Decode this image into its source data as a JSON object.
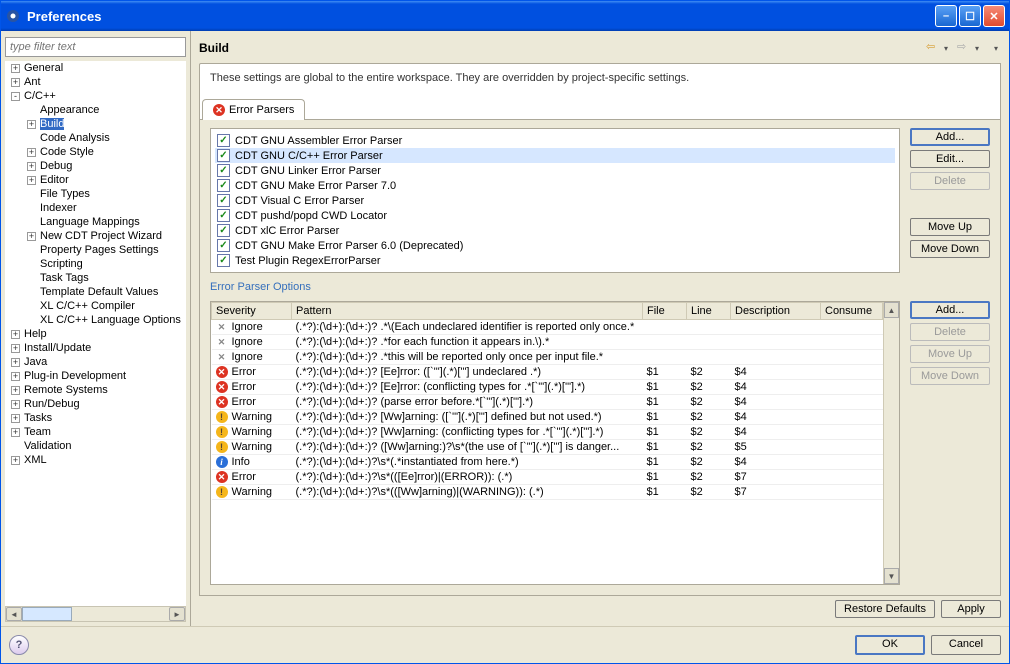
{
  "window": {
    "title": "Preferences"
  },
  "filter": {
    "placeholder": "type filter text"
  },
  "tree": [
    {
      "label": "General",
      "depth": 0,
      "toggle": "+"
    },
    {
      "label": "Ant",
      "depth": 0,
      "toggle": "+"
    },
    {
      "label": "C/C++",
      "depth": 0,
      "toggle": "-"
    },
    {
      "label": "Appearance",
      "depth": 1,
      "toggle": ""
    },
    {
      "label": "Build",
      "depth": 1,
      "toggle": "+",
      "selected": true
    },
    {
      "label": "Code Analysis",
      "depth": 1,
      "toggle": ""
    },
    {
      "label": "Code Style",
      "depth": 1,
      "toggle": "+"
    },
    {
      "label": "Debug",
      "depth": 1,
      "toggle": "+"
    },
    {
      "label": "Editor",
      "depth": 1,
      "toggle": "+"
    },
    {
      "label": "File Types",
      "depth": 1,
      "toggle": ""
    },
    {
      "label": "Indexer",
      "depth": 1,
      "toggle": ""
    },
    {
      "label": "Language Mappings",
      "depth": 1,
      "toggle": ""
    },
    {
      "label": "New CDT Project Wizard",
      "depth": 1,
      "toggle": "+"
    },
    {
      "label": "Property Pages Settings",
      "depth": 1,
      "toggle": ""
    },
    {
      "label": "Scripting",
      "depth": 1,
      "toggle": ""
    },
    {
      "label": "Task Tags",
      "depth": 1,
      "toggle": ""
    },
    {
      "label": "Template Default Values",
      "depth": 1,
      "toggle": ""
    },
    {
      "label": "XL C/C++ Compiler",
      "depth": 1,
      "toggle": ""
    },
    {
      "label": "XL C/C++ Language Options",
      "depth": 1,
      "toggle": ""
    },
    {
      "label": "Help",
      "depth": 0,
      "toggle": "+"
    },
    {
      "label": "Install/Update",
      "depth": 0,
      "toggle": "+"
    },
    {
      "label": "Java",
      "depth": 0,
      "toggle": "+"
    },
    {
      "label": "Plug-in Development",
      "depth": 0,
      "toggle": "+"
    },
    {
      "label": "Remote Systems",
      "depth": 0,
      "toggle": "+"
    },
    {
      "label": "Run/Debug",
      "depth": 0,
      "toggle": "+"
    },
    {
      "label": "Tasks",
      "depth": 0,
      "toggle": "+"
    },
    {
      "label": "Team",
      "depth": 0,
      "toggle": "+"
    },
    {
      "label": "Validation",
      "depth": 0,
      "toggle": ""
    },
    {
      "label": "XML",
      "depth": 0,
      "toggle": "+"
    }
  ],
  "page": {
    "title": "Build",
    "description": "These settings are global to the entire workspace.  They are overridden by project-specific settings.",
    "tab_label": "Error Parsers",
    "options_label": "Error Parser Options"
  },
  "parsers": [
    {
      "label": "CDT GNU Assembler Error Parser",
      "checked": true
    },
    {
      "label": "CDT GNU C/C++ Error Parser",
      "checked": true,
      "selected": true
    },
    {
      "label": "CDT GNU Linker Error Parser",
      "checked": true
    },
    {
      "label": "CDT GNU Make Error Parser 7.0",
      "checked": true
    },
    {
      "label": "CDT Visual C Error Parser",
      "checked": true
    },
    {
      "label": "CDT pushd/popd CWD Locator",
      "checked": true
    },
    {
      "label": "CDT xlC Error Parser",
      "checked": true
    },
    {
      "label": "CDT GNU Make Error Parser 6.0 (Deprecated)",
      "checked": true
    },
    {
      "label": "Test Plugin RegexErrorParser",
      "checked": true
    }
  ],
  "parsers_buttons": {
    "add": "Add...",
    "edit": "Edit...",
    "delete": "Delete",
    "moveup": "Move Up",
    "movedown": "Move Down"
  },
  "opts_buttons": {
    "add": "Add...",
    "delete": "Delete",
    "moveup": "Move Up",
    "movedown": "Move Down"
  },
  "columns": {
    "severity": "Severity",
    "pattern": "Pattern",
    "file": "File",
    "line": "Line",
    "description": "Description",
    "consume": "Consume"
  },
  "rows": [
    {
      "sev": "Ignore",
      "pat": "(.*?):(\\d+):(\\d+:)? .*\\(Each undeclared identifier is reported only once.*",
      "file": "",
      "line": "",
      "desc": "",
      "cons": ""
    },
    {
      "sev": "Ignore",
      "pat": "(.*?):(\\d+):(\\d+:)? .*for each function it appears in.\\).*",
      "file": "",
      "line": "",
      "desc": "",
      "cons": ""
    },
    {
      "sev": "Ignore",
      "pat": "(.*?):(\\d+):(\\d+:)? .*this will be reported only once per input file.*",
      "file": "",
      "line": "",
      "desc": "",
      "cons": ""
    },
    {
      "sev": "Error",
      "pat": "(.*?):(\\d+):(\\d+:)? [Ee]rror: ([`'\"](.*)['\"] undeclared .*)",
      "file": "$1",
      "line": "$2",
      "desc": "$4",
      "cons": ""
    },
    {
      "sev": "Error",
      "pat": "(.*?):(\\d+):(\\d+:)? [Ee]rror: (conflicting types for .*[`'\"](.*)['\"].*)",
      "file": "$1",
      "line": "$2",
      "desc": "$4",
      "cons": ""
    },
    {
      "sev": "Error",
      "pat": "(.*?):(\\d+):(\\d+:)? (parse error before.*[`'\"](.*)['\"].*)",
      "file": "$1",
      "line": "$2",
      "desc": "$4",
      "cons": ""
    },
    {
      "sev": "Warning",
      "pat": "(.*?):(\\d+):(\\d+:)? [Ww]arning: ([`'\"](.*)['\"] defined but not used.*)",
      "file": "$1",
      "line": "$2",
      "desc": "$4",
      "cons": ""
    },
    {
      "sev": "Warning",
      "pat": "(.*?):(\\d+):(\\d+:)? [Ww]arning: (conflicting types for .*[`'\"](.*)['\"].*)",
      "file": "$1",
      "line": "$2",
      "desc": "$4",
      "cons": ""
    },
    {
      "sev": "Warning",
      "pat": "(.*?):(\\d+):(\\d+:)? ([Ww]arning:)?\\s*(the use of [`'\"](.*)['\"] is danger...",
      "file": "$1",
      "line": "$2",
      "desc": "$5",
      "cons": ""
    },
    {
      "sev": "Info",
      "pat": "(.*?):(\\d+):(\\d+:)?\\s*(.*instantiated from here.*)",
      "file": "$1",
      "line": "$2",
      "desc": "$4",
      "cons": ""
    },
    {
      "sev": "Error",
      "pat": "(.*?):(\\d+):(\\d+:)?\\s*(([Ee]rror)|(ERROR)): (.*)",
      "file": "$1",
      "line": "$2",
      "desc": "$7",
      "cons": ""
    },
    {
      "sev": "Warning",
      "pat": "(.*?):(\\d+):(\\d+:)?\\s*(([Ww]arning)|(WARNING)): (.*)",
      "file": "$1",
      "line": "$2",
      "desc": "$7",
      "cons": ""
    }
  ],
  "footer": {
    "restore": "Restore Defaults",
    "apply": "Apply",
    "ok": "OK",
    "cancel": "Cancel"
  }
}
